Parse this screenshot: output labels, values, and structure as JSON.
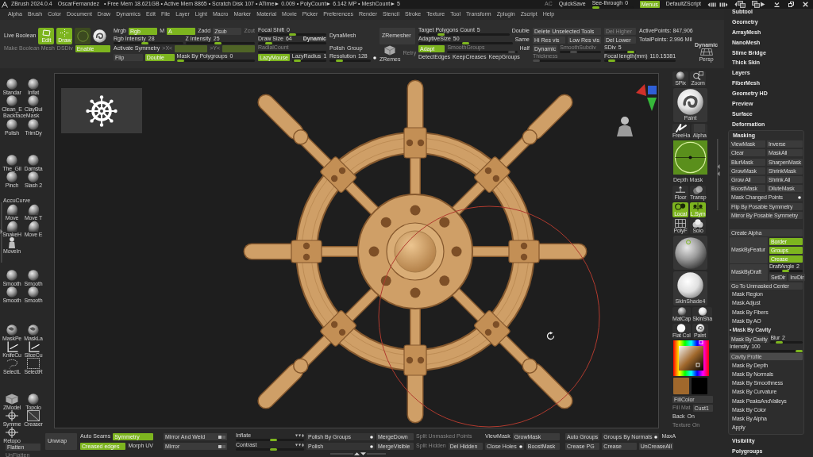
{
  "title_bar": {
    "app_name": "ZBrush 2024.0.4",
    "user": "OscarFernandez",
    "stats": "• Free Mem 18.621GB • Active Mem 8865 • Scratch Disk 107 • ATime► 0.009 • PolyCount► 6.142 MP • MeshCount► 5",
    "controls": [
      {
        "kind": "label",
        "label": "AC",
        "disabled": true
      },
      {
        "kind": "label",
        "label": "QuickSave"
      },
      {
        "kind": "slider",
        "label": "See-through",
        "value": "0",
        "level": 0
      },
      {
        "kind": "toggle",
        "label": "Menus",
        "on": true
      },
      {
        "kind": "label",
        "label": "DefaultZScript"
      }
    ]
  },
  "menu_bar": [
    "Alpha",
    "Brush",
    "Color",
    "Document",
    "Draw",
    "Dynamics",
    "Edit",
    "File",
    "Layer",
    "Light",
    "Macro",
    "Marker",
    "Material",
    "Movie",
    "Picker",
    "Preferences",
    "Render",
    "Stencil",
    "Stroke",
    "Texture",
    "Tool",
    "Transform",
    "Zplugin",
    "Zscript",
    "Help"
  ],
  "top_shelf": {
    "groups": [
      {
        "rows": [
          {
            "controls": [
              {
                "kind": "label",
                "label": "Live Boolean"
              },
              {
                "kind": "tool",
                "label": "Edit",
                "selected": true
              },
              {
                "kind": "tool",
                "label": "Draw",
                "selected": true
              },
              {
                "kind": "tool",
                "selected": false
              },
              {
                "kind": "icon-tool"
              }
            ]
          },
          {
            "controls": [
              {
                "kind": "label",
                "label": "Make Boolean Mesh",
                "disabled": true
              },
              {
                "kind": "label",
                "label": "DSDiv",
                "disabled": true
              },
              {
                "kind": "toggle",
                "label": "Enable",
                "on": true
              }
            ]
          }
        ]
      },
      {
        "rows": [
          {
            "controls": [
              {
                "kind": "label",
                "label": "Mrgb"
              },
              {
                "kind": "toggle",
                "label": "Rgb",
                "on": true
              },
              {
                "kind": "label",
                "label": "M"
              },
              {
                "kind": "toggle",
                "label": "A",
                "on": true
              },
              {
                "kind": "label",
                "label": "Zadd"
              },
              {
                "kind": "toggle",
                "label": "Zsub",
                "on": false
              },
              {
                "kind": "label",
                "label": "Zcut",
                "disabled": true
              }
            ]
          },
          {
            "controls": [
              {
                "kind": "slider",
                "label": "Rgb Intensity",
                "value": "28",
                "level": 0.45
              },
              {
                "kind": "slider",
                "label": "Z Intensity",
                "value": "25",
                "level": 0.47
              }
            ]
          },
          {
            "controls": [
              {
                "kind": "label",
                "label": "Activate Symmetry"
              },
              {
                "kind": "label",
                "label": ">X<",
                "disabled": true
              },
              {
                "kind": "toggle",
                "on": true,
                "disabled": true
              },
              {
                "kind": "label",
                "label": ">Y<",
                "disabled": true
              },
              {
                "kind": "toggle",
                "on": true,
                "disabled": true
              }
            ]
          },
          {
            "controls": [
              {
                "kind": "toggle",
                "label": "Flip",
                "on": false
              },
              {
                "kind": "toggle",
                "label": "Double",
                "on": true
              },
              {
                "kind": "slider",
                "label": "Mask By Polygroups",
                "value": "0",
                "level": 0
              }
            ]
          }
        ]
      },
      {
        "rows": [
          {
            "controls": [
              {
                "kind": "slider",
                "label": "Focal Shift",
                "value": "0",
                "level": 0.5
              }
            ]
          },
          {
            "controls": [
              {
                "kind": "slider",
                "label": "Draw Size",
                "value": "64",
                "tag": "Dynamic",
                "level": 0.12
              }
            ]
          },
          {
            "controls": [
              {
                "kind": "slider",
                "label": "RadialCount",
                "disabled": true
              }
            ]
          },
          {
            "controls": [
              {
                "kind": "toggle",
                "label": "LazyMouse",
                "on": true
              },
              {
                "kind": "slider",
                "label": "LazyRadius",
                "value": "1",
                "level": 0.05
              }
            ]
          }
        ]
      },
      {
        "rows": [
          {
            "controls": [
              {
                "kind": "heading",
                "label": "DynaMesh"
              }
            ]
          },
          {
            "controls": [
              {
                "kind": "label",
                "label": "Polish"
              },
              {
                "kind": "label",
                "label": "Group"
              }
            ]
          },
          {
            "controls": [
              {
                "kind": "slider",
                "label": "Resolution",
                "value": "128",
                "level": 0.18
              },
              {
                "kind": "dot",
                "on": true
              }
            ]
          }
        ]
      },
      {
        "rows": [
          {
            "controls": [
              {
                "kind": "heading-button",
                "label": "ZRemesher"
              }
            ]
          },
          {
            "controls": [
              {
                "kind": "icon-tool",
                "label": "ZRemes"
              },
              {
                "kind": "label",
                "label": "Retry",
                "disabled": true
              }
            ]
          }
        ]
      },
      {
        "rows": [
          {
            "controls": [
              {
                "kind": "slider",
                "label": "Target Polygons Count",
                "value": "5",
                "level": 0.23
              },
              {
                "kind": "label",
                "label": "Double"
              }
            ]
          },
          {
            "controls": [
              {
                "kind": "slider",
                "label": "AdaptiveSize",
                "value": "50",
                "level": 0.5
              },
              {
                "kind": "label",
                "label": "Same"
              }
            ]
          },
          {
            "controls": [
              {
                "kind": "toggle",
                "label": "Adapt",
                "on": true
              },
              {
                "kind": "slider",
                "label": "SmoothGroups",
                "disabled": true,
                "level": 0.97
              },
              {
                "kind": "label",
                "label": "Half"
              }
            ]
          },
          {
            "controls": [
              {
                "kind": "label",
                "label": "DetectEdges"
              },
              {
                "kind": "label",
                "label": "KeepCreases"
              },
              {
                "kind": "label",
                "label": "KeepGroups"
              }
            ]
          }
        ]
      },
      {
        "rows": [
          {
            "controls": [
              {
                "kind": "button",
                "label": "Delete Unselected Tools"
              }
            ]
          },
          {
            "controls": [
              {
                "kind": "button",
                "label": "Hi Res vis"
              },
              {
                "kind": "button",
                "label": "Low Res vis"
              }
            ]
          },
          {
            "controls": [
              {
                "kind": "button",
                "label": "Dynamic"
              },
              {
                "kind": "slider",
                "label": "SmoothSubdiv",
                "disabled": true,
                "level": 0.3
              }
            ]
          },
          {
            "controls": [
              {
                "kind": "slider",
                "label": "Thickness",
                "disabled": true,
                "level": 0
              }
            ]
          }
        ]
      },
      {
        "rows": [
          {
            "controls": [
              {
                "kind": "button",
                "label": "Del Higher",
                "disabled": true
              }
            ]
          },
          {
            "controls": [
              {
                "kind": "button",
                "label": "Del Lower"
              }
            ]
          },
          {
            "controls": [
              {
                "kind": "slider",
                "label": "SDiv",
                "value": "5",
                "level": 0.95
              }
            ]
          },
          {
            "controls": [
              {
                "kind": "slider",
                "label": "Focal length(mm)",
                "value": "110.15381",
                "level": 0.06
              }
            ]
          }
        ]
      },
      {
        "rows": [
          {
            "controls": [
              {
                "kind": "info",
                "label": "ActivePoints: 847,906"
              }
            ]
          },
          {
            "controls": [
              {
                "kind": "info",
                "label": "TotalPoints: 2.996 Mil"
              }
            ]
          }
        ]
      },
      {
        "rows": [
          {
            "controls": [
              {
                "kind": "icon-tool",
                "caption": "Dynamic",
                "label": "Persp"
              }
            ]
          }
        ]
      }
    ]
  },
  "left_shelf": {
    "groups": [
      [
        {
          "kind": "pair",
          "items": [
            {
              "label": "Standar"
            },
            {
              "label": "Inflat"
            }
          ]
        },
        {
          "kind": "pair",
          "items": [
            {
              "label": "Clean_E"
            },
            {
              "label": "ClayBui"
            }
          ]
        },
        {
          "kind": "text",
          "label": "BackfaceMask"
        },
        {
          "kind": "pair",
          "items": [
            {
              "label": "Polish"
            },
            {
              "label": "TrimDy"
            }
          ]
        }
      ],
      [
        {
          "kind": "pair",
          "items": [
            {
              "label": "The_Gil"
            },
            {
              "label": "Damsta"
            }
          ]
        },
        {
          "kind": "pair",
          "items": [
            {
              "label": "Pinch"
            },
            {
              "label": "Slash 2"
            }
          ]
        }
      ],
      [
        {
          "kind": "text",
          "label": "AccuCurve"
        },
        {
          "kind": "pair",
          "items": [
            {
              "label": "Move"
            },
            {
              "label": "Move T"
            }
          ]
        },
        {
          "kind": "pair",
          "items": [
            {
              "label": "SnakeH"
            },
            {
              "label": "Move E"
            }
          ]
        },
        {
          "kind": "pair",
          "items": [
            {
              "label": "MoveIn"
            }
          ]
        }
      ],
      [
        {
          "kind": "pair",
          "items": [
            {
              "label": "Smooth"
            },
            {
              "label": "Smooth"
            }
          ]
        },
        {
          "kind": "pair",
          "items": [
            {
              "label": "Smooth"
            },
            {
              "label": "Smooth"
            }
          ]
        }
      ],
      [
        {
          "kind": "pair",
          "items": [
            {
              "label": "MaskPe"
            },
            {
              "label": "MaskLa"
            }
          ]
        },
        {
          "kind": "pair",
          "items": [
            {
              "label": "KnifeCu"
            },
            {
              "label": "SliceCu"
            }
          ]
        },
        {
          "kind": "pair",
          "items": [
            {
              "label": "SelectL"
            },
            {
              "label": "SelectR"
            }
          ]
        }
      ],
      [
        {
          "kind": "pair",
          "items": [
            {
              "label": "ZModel"
            },
            {
              "label": "Topolo"
            }
          ]
        },
        {
          "kind": "pair",
          "items": [
            {
              "label": "Symme"
            },
            {
              "label": "Creaser"
            }
          ]
        },
        {
          "kind": "pair",
          "items": [
            {
              "label": "Retopo"
            }
          ]
        }
      ]
    ],
    "buttons": [
      {
        "kind": "button",
        "label": "Flatten"
      },
      {
        "kind": "label",
        "label": "UnFlatten",
        "disabled": true
      }
    ]
  },
  "right_shelf": [
    {
      "kind": "pair",
      "items": [
        {
          "label": "SPix",
          "on": false
        },
        {
          "label": "Zoom",
          "on": false
        }
      ]
    },
    {
      "kind": "big",
      "label": "Paint"
    },
    {
      "kind": "pair",
      "items": [
        {
          "label": "FreeHa",
          "on": false
        },
        {
          "label": "Alpha",
          "on": false
        }
      ]
    },
    {
      "kind": "depth",
      "label": "Depth Mask"
    },
    {
      "kind": "pair",
      "items": [
        {
          "label": "Floor",
          "on": false
        },
        {
          "label": "Transp",
          "on": false
        }
      ]
    },
    {
      "kind": "pair",
      "items": [
        {
          "label": "Local",
          "on": true
        },
        {
          "label": "L.Sym",
          "on": true
        }
      ]
    },
    {
      "kind": "pair",
      "items": [
        {
          "label": "PolyF",
          "on": false
        },
        {
          "label": "Solo",
          "on": false
        }
      ]
    },
    {
      "kind": "big"
    },
    {
      "kind": "big",
      "label": "SkinShade4"
    },
    {
      "kind": "pair",
      "items": [
        {
          "label": "MatCap",
          "on": false
        },
        {
          "label": "SkinSha",
          "on": false
        }
      ]
    },
    {
      "kind": "pair",
      "items": [
        {
          "label": "Flat Col",
          "on": false
        },
        {
          "label": "Paint",
          "on": false
        }
      ]
    },
    {
      "kind": "picker"
    },
    {
      "kind": "swatches",
      "items": [
        {
          "color": "#a0682c"
        },
        {
          "color": "#000000"
        }
      ]
    },
    {
      "kind": "row",
      "controls": [
        {
          "kind": "button",
          "label": "FillColor"
        }
      ]
    },
    {
      "kind": "row",
      "controls": [
        {
          "kind": "label",
          "label": "Fill Mat",
          "disabled": true
        },
        {
          "kind": "button",
          "label": "Cust1"
        }
      ]
    },
    {
      "kind": "row",
      "controls": [
        {
          "kind": "label",
          "label": "Back"
        },
        {
          "kind": "label",
          "label": "On"
        }
      ]
    },
    {
      "kind": "row",
      "controls": [
        {
          "kind": "label",
          "label": "Texture On",
          "disabled": true
        }
      ]
    }
  ],
  "bottom_bar": {
    "groups": [
      {
        "rows": [
          {
            "controls": [
              {
                "kind": "heading-button",
                "label": "Unwrap"
              }
            ]
          }
        ]
      },
      {
        "rows": [
          {
            "controls": [
              {
                "kind": "label",
                "label": "Auto Seams"
              },
              {
                "kind": "toggle",
                "label": "Symmetry",
                "on": true
              }
            ]
          },
          {
            "controls": [
              {
                "kind": "toggle",
                "label": "Creased edges",
                "on": true
              },
              {
                "kind": "label",
                "label": "Morph UV"
              }
            ]
          }
        ]
      },
      {
        "rows": [
          {
            "controls": [
              {
                "kind": "option-button",
                "label": "Mirror And Weld"
              }
            ]
          },
          {
            "controls": [
              {
                "kind": "option-button",
                "label": "Mirror"
              }
            ]
          }
        ]
      },
      {
        "rows": [
          {
            "controls": [
              {
                "kind": "option-slider",
                "label": "Inflate",
                "level": 0.56
              }
            ]
          },
          {
            "controls": [
              {
                "kind": "option-slider",
                "label": "Contrast",
                "level": 0.56
              }
            ]
          }
        ]
      },
      {
        "rows": [
          {
            "controls": [
              {
                "kind": "dot-button",
                "label": "Polish By Groups",
                "on": true
              }
            ]
          },
          {
            "controls": [
              {
                "kind": "dot-button",
                "label": "Polish",
                "on": true
              }
            ]
          }
        ]
      },
      {
        "rows": [
          {
            "controls": [
              {
                "kind": "button",
                "label": "MergeDown"
              }
            ]
          },
          {
            "controls": [
              {
                "kind": "button",
                "label": "MergeVisible"
              }
            ]
          }
        ]
      },
      {
        "rows": [
          {
            "controls": [
              {
                "kind": "label",
                "label": "Split Unmasked Points",
                "disabled": true
              }
            ]
          },
          {
            "controls": [
              {
                "kind": "label",
                "label": "Split Hidden",
                "disabled": true
              },
              {
                "kind": "button",
                "label": "Del Hidden"
              }
            ]
          }
        ]
      },
      {
        "rows": [
          {
            "controls": [
              {
                "kind": "label",
                "label": "ViewMask"
              },
              {
                "kind": "button",
                "label": "GrowMask"
              }
            ]
          },
          {
            "controls": [
              {
                "kind": "dot-button",
                "label": "Close Holes",
                "on": true
              },
              {
                "kind": "button",
                "label": "BoostMask"
              }
            ]
          }
        ]
      },
      {
        "rows": [
          {
            "controls": [
              {
                "kind": "button",
                "label": "Auto Groups"
              },
              {
                "kind": "dot-button",
                "label": "Groups By Normals",
                "on": true
              },
              {
                "kind": "label",
                "label": "MaxA"
              }
            ]
          },
          {
            "controls": [
              {
                "kind": "button",
                "label": "Crease PG"
              },
              {
                "kind": "button",
                "label": "Crease"
              },
              {
                "kind": "button",
                "label": "UnCreaseAll"
              }
            ]
          }
        ]
      }
    ]
  },
  "right_panel": {
    "palettes": [
      {
        "title": "Subtool",
        "expanded": false
      },
      {
        "title": "Geometry",
        "expanded": false
      },
      {
        "title": "ArrayMesh",
        "expanded": false
      },
      {
        "title": "NanoMesh",
        "expanded": false
      },
      {
        "title": "Slime Bridge",
        "expanded": false
      },
      {
        "title": "Thick Skin",
        "expanded": false
      },
      {
        "title": "Layers",
        "expanded": false
      },
      {
        "title": "FiberMesh",
        "expanded": false
      },
      {
        "title": "Geometry HD",
        "expanded": false
      },
      {
        "title": "Preview",
        "expanded": false
      },
      {
        "title": "Surface",
        "expanded": false
      },
      {
        "title": "Deformation",
        "expanded": false
      },
      {
        "title": "Masking",
        "expanded": true,
        "sections": [
          [
            {
              "kind": "row",
              "controls": [
                {
                  "kind": "button",
                  "label": "ViewMask"
                },
                {
                  "kind": "button",
                  "label": "Inverse"
                }
              ]
            },
            {
              "kind": "row",
              "controls": [
                {
                  "kind": "button",
                  "label": "Clear"
                },
                {
                  "kind": "button",
                  "label": "MaskAll"
                }
              ]
            },
            {
              "kind": "row",
              "controls": [
                {
                  "kind": "button",
                  "label": "BlurMask"
                },
                {
                  "kind": "button",
                  "label": "SharpenMask"
                }
              ]
            },
            {
              "kind": "row",
              "controls": [
                {
                  "kind": "button",
                  "label": "GrowMask"
                },
                {
                  "kind": "button",
                  "label": "ShrinkMask"
                }
              ]
            },
            {
              "kind": "row",
              "controls": [
                {
                  "kind": "button",
                  "label": "Grow All"
                },
                {
                  "kind": "button",
                  "label": "Shrink All"
                }
              ]
            },
            {
              "kind": "row",
              "controls": [
                {
                  "kind": "button",
                  "label": "BoostMask"
                },
                {
                  "kind": "button",
                  "label": "DiluteMask"
                }
              ]
            },
            {
              "kind": "row",
              "controls": [
                {
                  "kind": "dot-button",
                  "label": "Mask Changed Points",
                  "on": true
                }
              ]
            },
            {
              "kind": "row",
              "controls": [
                {
                  "kind": "button",
                  "label": "Flip By Posable Symmetry"
                }
              ]
            },
            {
              "kind": "row",
              "controls": [
                {
                  "kind": "button",
                  "label": "Mirror By Posable Symmetry"
                }
              ]
            }
          ],
          [
            {
              "kind": "row",
              "controls": [
                {
                  "kind": "button",
                  "label": "Create Alpha"
                }
              ]
            },
            {
              "kind": "block",
              "button": "MaskByFeatur",
              "rows": [
                {
                  "controls": [
                    {
                      "kind": "toggle",
                      "label": "Border",
                      "on": true
                    }
                  ]
                },
                {
                  "controls": [
                    {
                      "kind": "toggle",
                      "label": "Groups",
                      "on": true
                    }
                  ]
                },
                {
                  "controls": [
                    {
                      "kind": "toggle",
                      "label": "Crease",
                      "on": true
                    }
                  ]
                }
              ]
            },
            {
              "kind": "block",
              "button": "MaskByDraft",
              "rows": [
                {
                  "controls": [
                    {
                      "kind": "slider",
                      "label": "DraftAngle",
                      "value": "2",
                      "level": 0.48
                    }
                  ]
                },
                {
                  "controls": [
                    {
                      "kind": "button",
                      "label": "SetDir"
                    },
                    {
                      "kind": "button",
                      "label": "InvDir"
                    }
                  ]
                }
              ]
            },
            {
              "kind": "row",
              "controls": [
                {
                  "kind": "button",
                  "label": "Go To Unmasked Center"
                }
              ]
            },
            {
              "kind": "sub",
              "title": "Mask Region",
              "expanded": false
            },
            {
              "kind": "sub",
              "title": "Mask Adjust",
              "expanded": false
            },
            {
              "kind": "sub",
              "title": "Mask By Fibers",
              "expanded": false
            },
            {
              "kind": "sub",
              "title": "Mask By AO",
              "expanded": false
            },
            {
              "kind": "sub",
              "title": "Mask By Cavity",
              "expanded": true,
              "rows": [
                {
                  "controls": [
                    {
                      "kind": "button",
                      "label": "Mask By Cavity"
                    },
                    {
                      "kind": "slider",
                      "label": "Blur",
                      "value": "2",
                      "level": 0.2
                    }
                  ]
                },
                {
                  "controls": [
                    {
                      "kind": "slider",
                      "label": "Intensity",
                      "value": "100",
                      "level": 1
                    }
                  ]
                },
                {
                  "controls": [
                    {
                      "kind": "curve",
                      "label": "Cavity Profile"
                    }
                  ]
                }
              ]
            },
            {
              "kind": "sub",
              "title": "Mask By Depth",
              "expanded": false
            },
            {
              "kind": "sub",
              "title": "Mask By Normals",
              "expanded": false
            },
            {
              "kind": "sub",
              "title": "Mask By Smoothness",
              "expanded": false
            },
            {
              "kind": "sub",
              "title": "Mask By Curvature",
              "expanded": false
            },
            {
              "kind": "sub",
              "title": "Mask PeaksAndValleys",
              "expanded": false
            },
            {
              "kind": "sub",
              "title": "Mask By Color",
              "expanded": false
            },
            {
              "kind": "sub",
              "title": "Mask By Alpha",
              "expanded": false
            },
            {
              "kind": "sub",
              "title": "Apply",
              "expanded": false
            }
          ]
        ]
      },
      {
        "title": "Visibility",
        "expanded": false
      },
      {
        "title": "Polygroups",
        "expanded": false
      }
    ]
  }
}
